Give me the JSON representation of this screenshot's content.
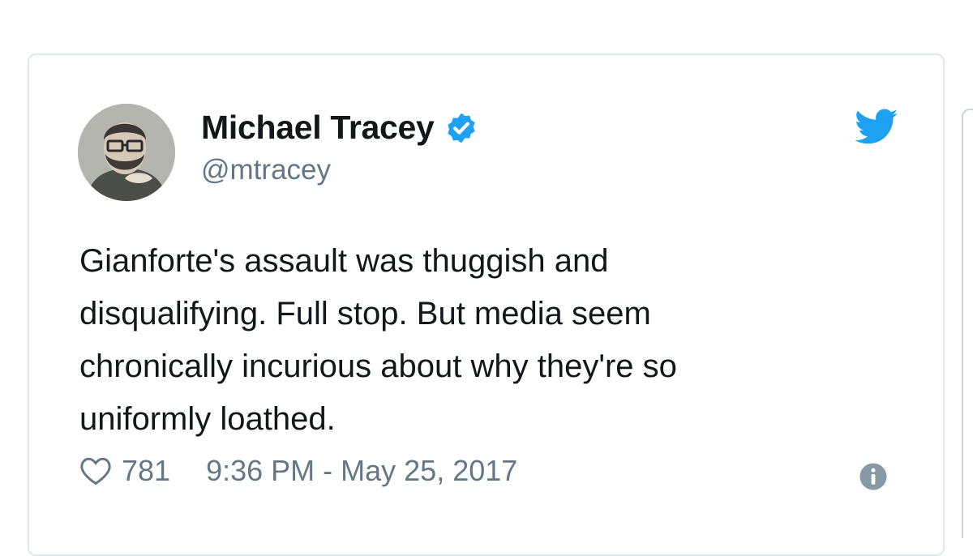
{
  "tweet": {
    "author_name": "Michael Tracey",
    "handle": "@mtracey",
    "verified": true,
    "text": "Gianforte's assault was thuggish and\ndisqualifying. Full stop. But media seem\nchronically incurious about why they're so\nuniformly loathed.",
    "likes": "781",
    "timestamp": "9:36 PM - May 25, 2017"
  },
  "icons": {
    "verified": "verified-badge-icon",
    "brand": "twitter-bird-icon",
    "like": "heart-icon",
    "info": "info-icon"
  },
  "colors": {
    "brand_blue": "#1da1f2",
    "text_primary": "#14171a",
    "text_secondary": "#657786",
    "border": "#e1e8ed"
  }
}
